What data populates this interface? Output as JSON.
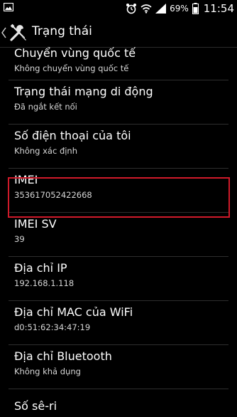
{
  "status_bar": {
    "battery_percent": "69%",
    "time": "11:54",
    "icons": [
      "image-icon",
      "alarm-icon",
      "wifi-icon",
      "signal-icon",
      "battery-icon"
    ]
  },
  "action_bar": {
    "title": "Trạng thái",
    "icon": "settings-tools-icon"
  },
  "items": [
    {
      "title": "Chuyển vùng quốc tế",
      "subtitle": "Không chuyển vùng quốc tế"
    },
    {
      "title": "Trạng thái mạng di động",
      "subtitle": "Đã ngắt kết nối"
    },
    {
      "title": "Số điện thoại của tôi",
      "subtitle": "Không xác định"
    },
    {
      "title": "IMEI",
      "subtitle": "353617052422668"
    },
    {
      "title": "IMEI SV",
      "subtitle": "39"
    },
    {
      "title": "Địa chỉ IP",
      "subtitle": "192.168.1.118"
    },
    {
      "title": "Địa chỉ MAC của WiFi",
      "subtitle": "d0:51:62:34:47:19"
    },
    {
      "title": "Địa chỉ Bluetooth",
      "subtitle": "Không khả dụng"
    },
    {
      "title": "Số sê-ri",
      "subtitle": ""
    }
  ],
  "colors": {
    "highlight": "#d01a2a",
    "background": "#000000",
    "text": "#ffffff"
  }
}
